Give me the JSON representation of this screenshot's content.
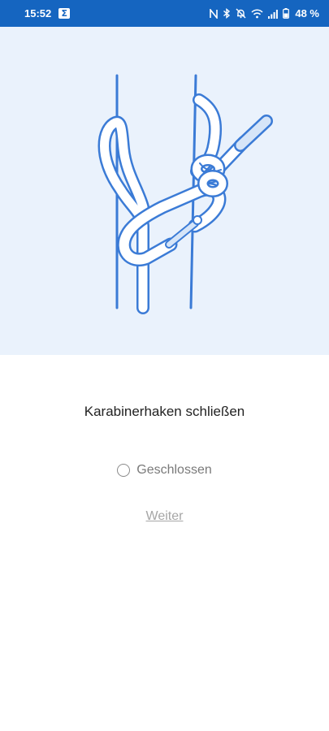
{
  "status_bar": {
    "time": "15:52",
    "app_badge": "Σ",
    "battery_text": "48 %",
    "icons": [
      "nfc-icon",
      "bluetooth-icon",
      "muted-bell-icon",
      "wifi-icon",
      "signal-icon",
      "battery-icon"
    ]
  },
  "illustration": {
    "icon": "carabiner-knot-illustration",
    "background": "#eaf2fc",
    "rope_color": "#3b7bd6"
  },
  "step": {
    "title": "Karabinerhaken schließen"
  },
  "checkbox": {
    "label": "Geschlossen",
    "checked": false
  },
  "actions": {
    "next_label": "Weiter"
  },
  "colors": {
    "status_bar": "#1565c0",
    "accent": "#3b7bd6"
  }
}
